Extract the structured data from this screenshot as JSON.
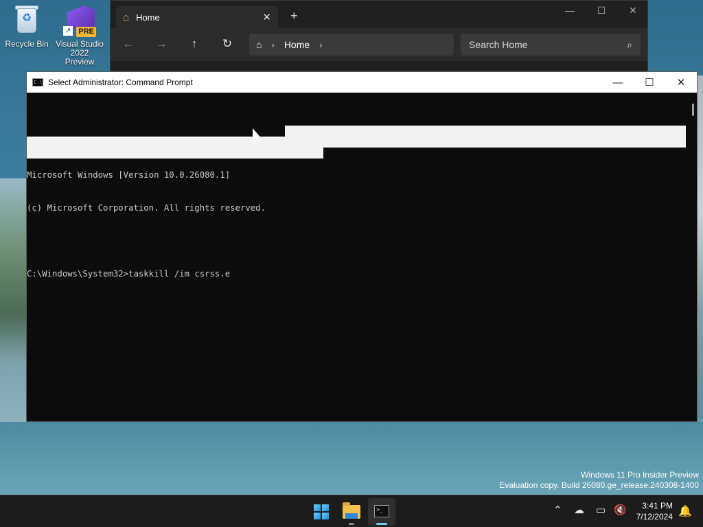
{
  "desktop": {
    "icons": [
      {
        "label": "Recycle Bin"
      },
      {
        "label": "Visual Studio 2022 Preview",
        "badge": "PRE"
      }
    ]
  },
  "explorer": {
    "tab_label": "Home",
    "address": {
      "segment": "Home"
    },
    "search_placeholder": "Search Home"
  },
  "cmd": {
    "title": "Select Administrator: Command Prompt",
    "icon_text": "C:\\",
    "lines": [
      "Microsoft Windows [Version 10.0.26080.1]",
      "(c) Microsoft Corporation. All rights reserved.",
      "",
      "C:\\Windows\\System32>taskkill /im csrss.e"
    ]
  },
  "watermark": {
    "line1": "Windows 11 Pro Insider Preview",
    "line2": "Evaluation copy. Build 26080.ge_release.240308-1400"
  },
  "taskbar": {
    "terminal_icon_text": ">_",
    "clock": {
      "time": "3:41 PM",
      "date": "7/12/2024"
    }
  },
  "colors": {
    "accent": "#6ccff6",
    "cmd_bg": "#0c0c0c",
    "cmd_text": "#cccccc",
    "taskbar_bg": "#1c1c1c"
  }
}
